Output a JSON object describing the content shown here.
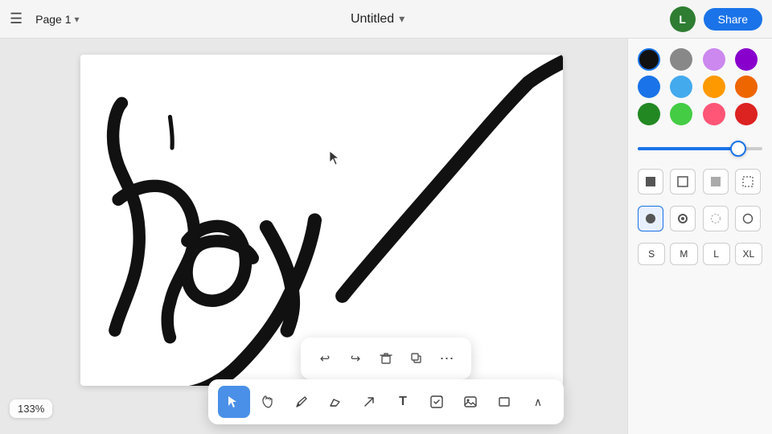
{
  "header": {
    "menu_icon": "☰",
    "page_label": "Page 1",
    "chevron_icon": "▾",
    "title": "Untitled",
    "title_chevron": "▾",
    "avatar_initials": "L",
    "share_label": "Share"
  },
  "colors": [
    {
      "id": "black",
      "value": "#111111",
      "selected": true
    },
    {
      "id": "gray",
      "value": "#888888",
      "selected": false
    },
    {
      "id": "lavender",
      "value": "#cc88ee",
      "selected": false
    },
    {
      "id": "purple",
      "value": "#8800cc",
      "selected": false
    },
    {
      "id": "blue",
      "value": "#1a73e8",
      "selected": false
    },
    {
      "id": "light-blue",
      "value": "#44aaee",
      "selected": false
    },
    {
      "id": "orange",
      "value": "#ff9900",
      "selected": false
    },
    {
      "id": "dark-orange",
      "value": "#ee6600",
      "selected": false
    },
    {
      "id": "dark-green",
      "value": "#228822",
      "selected": false
    },
    {
      "id": "green",
      "value": "#44cc44",
      "selected": false
    },
    {
      "id": "pink",
      "value": "#ff5577",
      "selected": false
    },
    {
      "id": "red",
      "value": "#dd2222",
      "selected": false
    }
  ],
  "slider": {
    "value": 85,
    "min": 0,
    "max": 100
  },
  "brush_styles": [
    {
      "id": "solid-square",
      "icon": "▪",
      "selected": false
    },
    {
      "id": "square-outline",
      "icon": "▫",
      "selected": false
    },
    {
      "id": "gray-square",
      "icon": "◫",
      "selected": false
    },
    {
      "id": "pattern-square",
      "icon": "▩",
      "selected": false
    }
  ],
  "nib_styles": [
    {
      "id": "filled-circle",
      "icon": "●",
      "selected": true
    },
    {
      "id": "ring-circle",
      "icon": "◉",
      "selected": false
    },
    {
      "id": "dotted-circle",
      "icon": "◌",
      "selected": false
    },
    {
      "id": "empty-circle",
      "icon": "○",
      "selected": false
    }
  ],
  "size_options": [
    {
      "id": "S",
      "label": "S",
      "selected": false
    },
    {
      "id": "M",
      "label": "M",
      "selected": false
    },
    {
      "id": "L",
      "label": "L",
      "selected": false
    },
    {
      "id": "XL",
      "label": "XL",
      "selected": false
    }
  ],
  "floating_toolbar": {
    "undo_label": "↩",
    "redo_label": "↪",
    "delete_label": "🗑",
    "duplicate_label": "⧉",
    "more_label": "⋯"
  },
  "bottom_tools": [
    {
      "id": "select",
      "icon": "↖",
      "active": true,
      "label": "Select"
    },
    {
      "id": "hand",
      "icon": "✋",
      "active": false,
      "label": "Hand"
    },
    {
      "id": "pencil",
      "icon": "✏",
      "active": false,
      "label": "Pencil"
    },
    {
      "id": "eraser",
      "icon": "⬜",
      "active": false,
      "label": "Eraser"
    },
    {
      "id": "arrow",
      "icon": "↗",
      "active": false,
      "label": "Arrow"
    },
    {
      "id": "text",
      "icon": "T",
      "active": false,
      "label": "Text"
    },
    {
      "id": "edit",
      "icon": "✎",
      "active": false,
      "label": "Edit"
    },
    {
      "id": "image",
      "icon": "⬛",
      "active": false,
      "label": "Image"
    },
    {
      "id": "frame",
      "icon": "▭",
      "active": false,
      "label": "Frame"
    },
    {
      "id": "more2",
      "icon": "∧",
      "active": false,
      "label": "More"
    }
  ],
  "zoom": {
    "level": "133%"
  },
  "help": {
    "label": "?"
  }
}
